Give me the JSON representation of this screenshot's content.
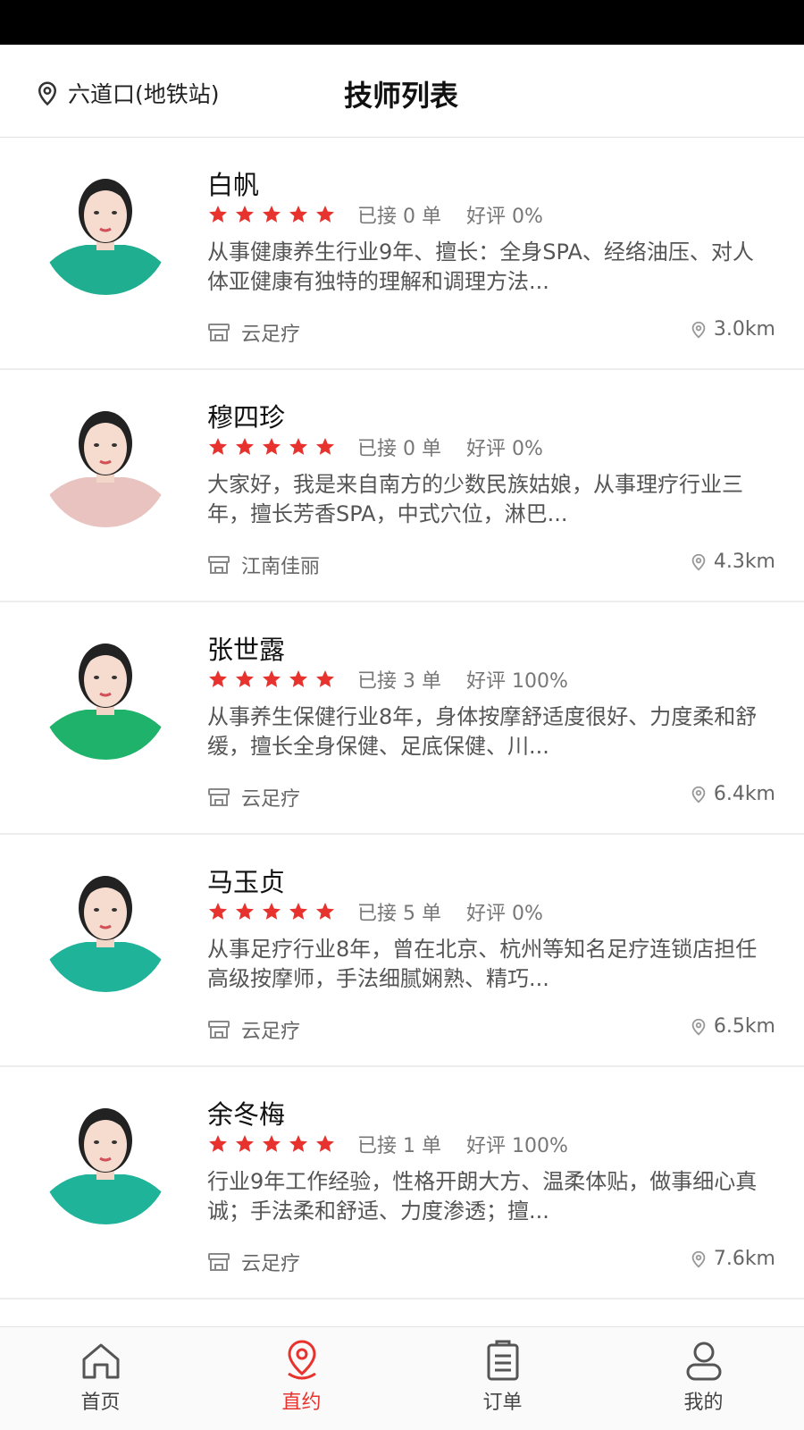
{
  "header": {
    "location": "六道口(地铁站)",
    "title": "技师列表"
  },
  "colors": {
    "accent": "#e8322e",
    "star": "#e8322e"
  },
  "technicians": [
    {
      "name": "白帆",
      "rating": 5,
      "orders": "已接 0 单",
      "praise": "好评 0%",
      "description": "从事健康养生行业9年、擅长：全身SPA、经络油压、对人体亚健康有独特的理解和调理方法...",
      "shop": "云足疗",
      "distance": "3.0km",
      "shirt_color": "#1fae8f"
    },
    {
      "name": "穆四珍",
      "rating": 5,
      "orders": "已接 0 单",
      "praise": "好评 0%",
      "description": "大家好，我是来自南方的少数民族姑娘，从事理疗行业三年，擅长芳香SPA，中式穴位，淋巴...",
      "shop": "江南佳丽",
      "distance": "4.3km",
      "shirt_color": "#e8c3c0"
    },
    {
      "name": "张世露",
      "rating": 5,
      "orders": "已接 3 单",
      "praise": "好评 100%",
      "description": "从事养生保健行业8年，身体按摩舒适度很好、力度柔和舒缓，擅长全身保健、足底保健、川...",
      "shop": "云足疗",
      "distance": "6.4km",
      "shirt_color": "#1fb26a"
    },
    {
      "name": "马玉贞",
      "rating": 5,
      "orders": "已接 5 单",
      "praise": "好评 0%",
      "description": "从事足疗行业8年，曾在北京、杭州等知名足疗连锁店担任高级按摩师，手法细腻娴熟、精巧...",
      "shop": "云足疗",
      "distance": "6.5km",
      "shirt_color": "#1fb39a"
    },
    {
      "name": "余冬梅",
      "rating": 5,
      "orders": "已接 1 单",
      "praise": "好评 100%",
      "description": "行业9年工作经验，性格开朗大方、温柔体贴，做事细心真诚；手法柔和舒适、力度渗透；擅...",
      "shop": "云足疗",
      "distance": "7.6km",
      "shirt_color": "#1fb39a"
    }
  ],
  "tabs": [
    {
      "label": "首页",
      "icon": "home-icon"
    },
    {
      "label": "直约",
      "icon": "location-pin-icon",
      "active": true
    },
    {
      "label": "订单",
      "icon": "order-list-icon"
    },
    {
      "label": "我的",
      "icon": "user-icon"
    }
  ]
}
